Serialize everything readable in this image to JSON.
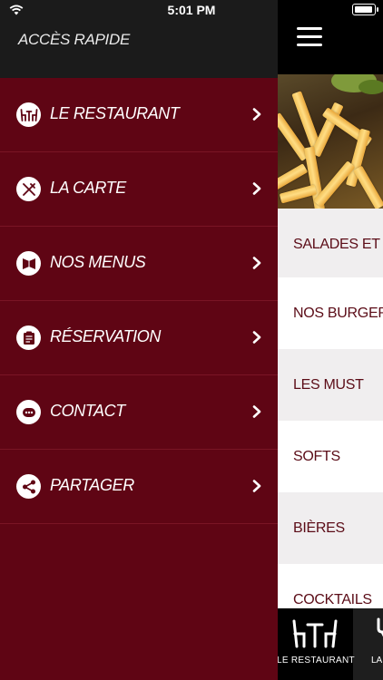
{
  "status_bar": {
    "time": "5:01 PM"
  },
  "drawer": {
    "title": "ACCÈS RAPIDE",
    "items": [
      {
        "label": "LE RESTAURANT",
        "icon": "restaurant-table-icon"
      },
      {
        "label": "LA CARTE",
        "icon": "utensils-icon"
      },
      {
        "label": "NOS MENUS",
        "icon": "menu-book-icon"
      },
      {
        "label": "RÉSERVATION",
        "icon": "reservation-clipboard-icon"
      },
      {
        "label": "CONTACT",
        "icon": "contact-chat-icon"
      },
      {
        "label": "PARTAGER",
        "icon": "share-icon"
      }
    ]
  },
  "categories": [
    "SALADES ET ENT",
    "NOS BURGERS /",
    "LES MUST",
    "SOFTS",
    "BIÈRES",
    "COCKTAILS"
  ],
  "tabbar": {
    "tabs": [
      {
        "label": "LE RESTAURANT",
        "icon": "restaurant-table-icon",
        "active": true
      },
      {
        "label": "LA",
        "icon": "utensils-icon",
        "active": false
      }
    ]
  },
  "colors": {
    "drawer_bg": "#5f0514",
    "accent_text": "#5b0c17",
    "header_bg": "#1b1b1b"
  }
}
